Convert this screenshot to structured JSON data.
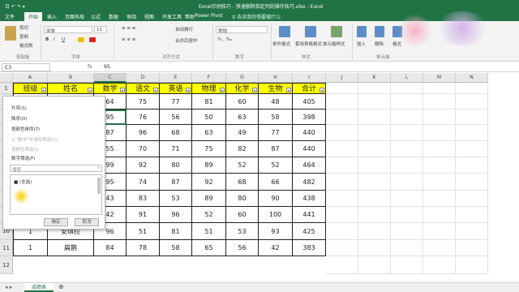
{
  "title": "Excel示例技巧 - 快速删除指定列的操作技巧.xlsx - Excel",
  "qat": "日 ↶ ↷ ▾",
  "tabs": [
    "文件",
    "开始",
    "插入",
    "页面布局",
    "公式",
    "数据",
    "审阅",
    "视图",
    "开发工具",
    "帮助",
    "Power Pivot"
  ],
  "tell_me": "♀ 告诉我你想要做什么",
  "ribbon": {
    "cut": "剪切",
    "copy": "复制",
    "painter": "格式刷",
    "font": "宋体",
    "size": "11",
    "wrap": "自动换行",
    "merge": "合并后居中",
    "format": "常规",
    "cond": "条件格式",
    "table": "套用表格格式",
    "styles": "单元格样式",
    "insert": "插入",
    "delete": "删除",
    "fmt": "格式",
    "g_clip": "剪贴板",
    "g_font": "字体",
    "g_align": "对齐方式",
    "g_num": "数字",
    "g_style": "样式",
    "g_cells": "单元格"
  },
  "formula": {
    "name": "C3",
    "fx": "fx",
    "value": "95"
  },
  "cols": [
    "A",
    "B",
    "C",
    "D",
    "E",
    "F",
    "G",
    "H",
    "I",
    "J",
    "K",
    "L",
    "M",
    "N"
  ],
  "rows": [
    "1",
    "2",
    "3",
    "4",
    "5",
    "6",
    "7",
    "8",
    "9",
    "10",
    "11",
    "12"
  ],
  "headers": [
    "班级",
    "姓名",
    "数学",
    "语文",
    "英语",
    "物理",
    "化学",
    "生物",
    "合计"
  ],
  "data": [
    [
      "",
      "",
      "64",
      "75",
      "77",
      "81",
      "60",
      "48",
      "405"
    ],
    [
      "",
      "",
      "95",
      "76",
      "56",
      "50",
      "63",
      "58",
      "398"
    ],
    [
      "",
      "",
      "87",
      "96",
      "68",
      "63",
      "49",
      "77",
      "440"
    ],
    [
      "",
      "",
      "55",
      "70",
      "71",
      "75",
      "82",
      "87",
      "440"
    ],
    [
      "",
      "",
      "99",
      "92",
      "80",
      "89",
      "52",
      "52",
      "464"
    ],
    [
      "",
      "",
      "95",
      "74",
      "87",
      "92",
      "68",
      "66",
      "482"
    ],
    [
      "",
      "",
      "43",
      "83",
      "53",
      "89",
      "80",
      "90",
      "438"
    ],
    [
      "1",
      "韩信",
      "42",
      "91",
      "96",
      "52",
      "60",
      "100",
      "441"
    ],
    [
      "1",
      "安琪拉",
      "96",
      "51",
      "81",
      "51",
      "53",
      "93",
      "425"
    ],
    [
      "1",
      "扁鹊",
      "84",
      "78",
      "58",
      "65",
      "56",
      "42",
      "383"
    ]
  ],
  "filter_menu": {
    "sort_asc": "升序(S)",
    "sort_desc": "降序(O)",
    "sort_color": "按颜色排序(T)",
    "clear": "从\"数学\"中清除筛选(C)",
    "color_filter": "按颜色筛选(I)",
    "num_filter": "数字筛选(F)",
    "search": "搜索",
    "select_all": "■ (全选)",
    "ok": "确定",
    "cancel": "取消"
  },
  "sheet_tab": "成绩表",
  "colors": {
    "excel_green": "#217346",
    "header_yellow": "#ffff00"
  }
}
